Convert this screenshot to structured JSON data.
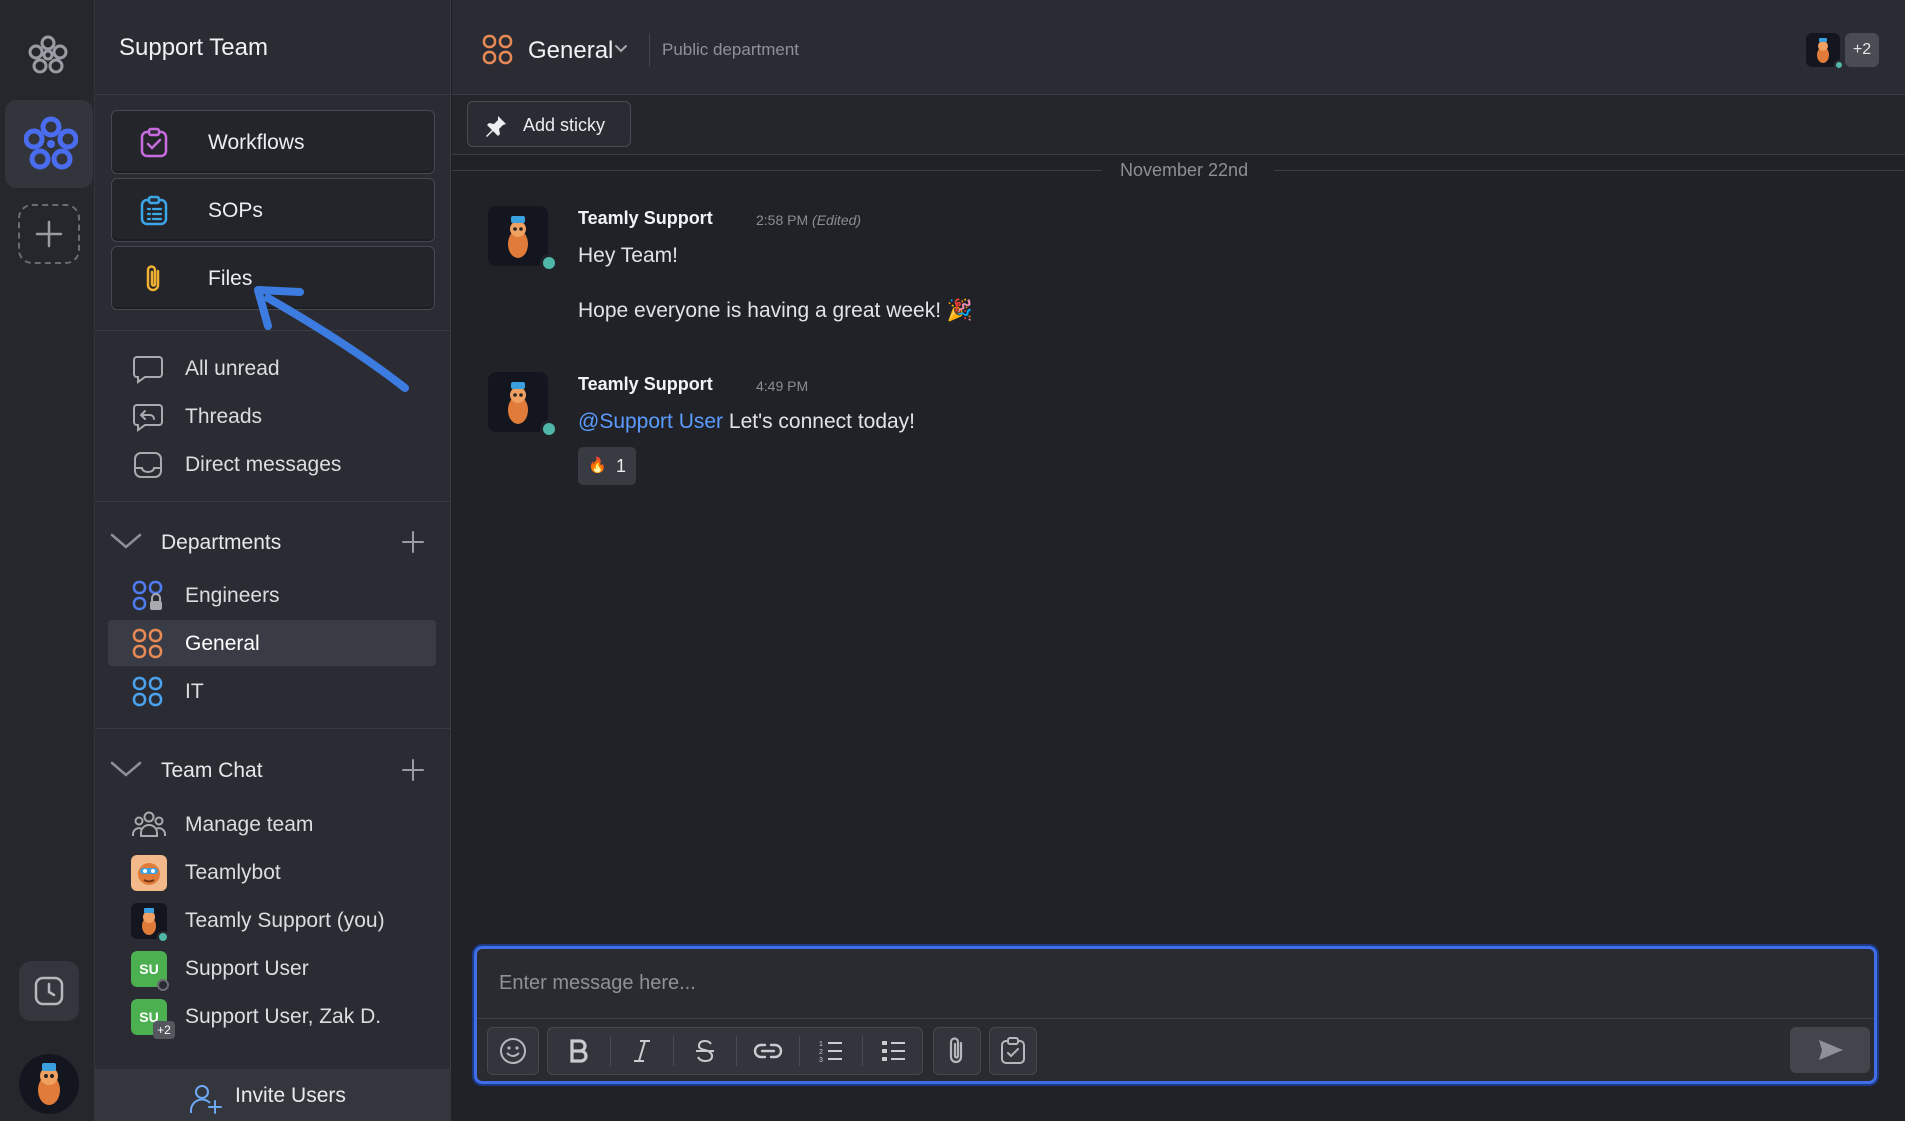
{
  "workspace": {
    "name": "Support Team"
  },
  "sidebar": {
    "features": [
      {
        "label": "Workflows",
        "icon": "workflows-icon",
        "color": "#c86be0"
      },
      {
        "label": "SOPs",
        "icon": "sops-icon",
        "color": "#3ba6e8"
      },
      {
        "label": "Files",
        "icon": "paperclip-icon",
        "color": "#f0b230"
      }
    ],
    "quick_nav": [
      {
        "label": "All unread",
        "icon": "chat-bubble-icon"
      },
      {
        "label": "Threads",
        "icon": "threads-icon"
      },
      {
        "label": "Direct messages",
        "icon": "inbox-icon"
      }
    ],
    "departments": {
      "title": "Departments",
      "items": [
        {
          "label": "Engineers",
          "icon": "department-locked-icon",
          "color": "#4f7cf0"
        },
        {
          "label": "General",
          "icon": "department-icon",
          "color": "#e88a55",
          "active": true
        },
        {
          "label": "IT",
          "icon": "department-icon",
          "color": "#4aa3f0"
        }
      ]
    },
    "team_chat": {
      "title": "Team Chat",
      "items": [
        {
          "label": "Manage team",
          "icon": "team-icon"
        },
        {
          "label": "Teamlybot",
          "icon": "teamlybot-avatar"
        },
        {
          "label": "Teamly Support (you)",
          "icon": "support-avatar",
          "status": "online"
        },
        {
          "label": "Support User",
          "badge": "SU",
          "status": "offline"
        },
        {
          "label": "Support User, Zak D.",
          "badge": "SU",
          "extra": "+2"
        }
      ]
    },
    "invite_label": "Invite Users"
  },
  "channel": {
    "name": "General",
    "description": "Public department",
    "member_extra": "+2",
    "add_sticky_label": "Add sticky"
  },
  "messages": {
    "date_separator": "November 22nd",
    "items": [
      {
        "author": "Teamly Support",
        "time": "2:58 PM",
        "edited": "(Edited)",
        "line1": "Hey Team!",
        "line2": "Hope everyone is having a great week! 🎉"
      },
      {
        "author": "Teamly Support",
        "time": "4:49 PM",
        "mention": "@Support User",
        "text": "Let's connect today!",
        "reaction_emoji": "🔥",
        "reaction_count": "1"
      }
    ]
  },
  "composer": {
    "placeholder": "Enter message here...",
    "tools": [
      "emoji-icon",
      "bold-icon",
      "italic-icon",
      "strikethrough-icon",
      "link-icon",
      "numbered-list-icon",
      "bulleted-list-icon",
      "paperclip-icon",
      "task-icon",
      "send-icon"
    ]
  },
  "colors": {
    "accent": "#3f6ee8",
    "online": "#4fb6a8",
    "mention": "#5b9cff",
    "annotation_arrow": "#3c7be0"
  }
}
